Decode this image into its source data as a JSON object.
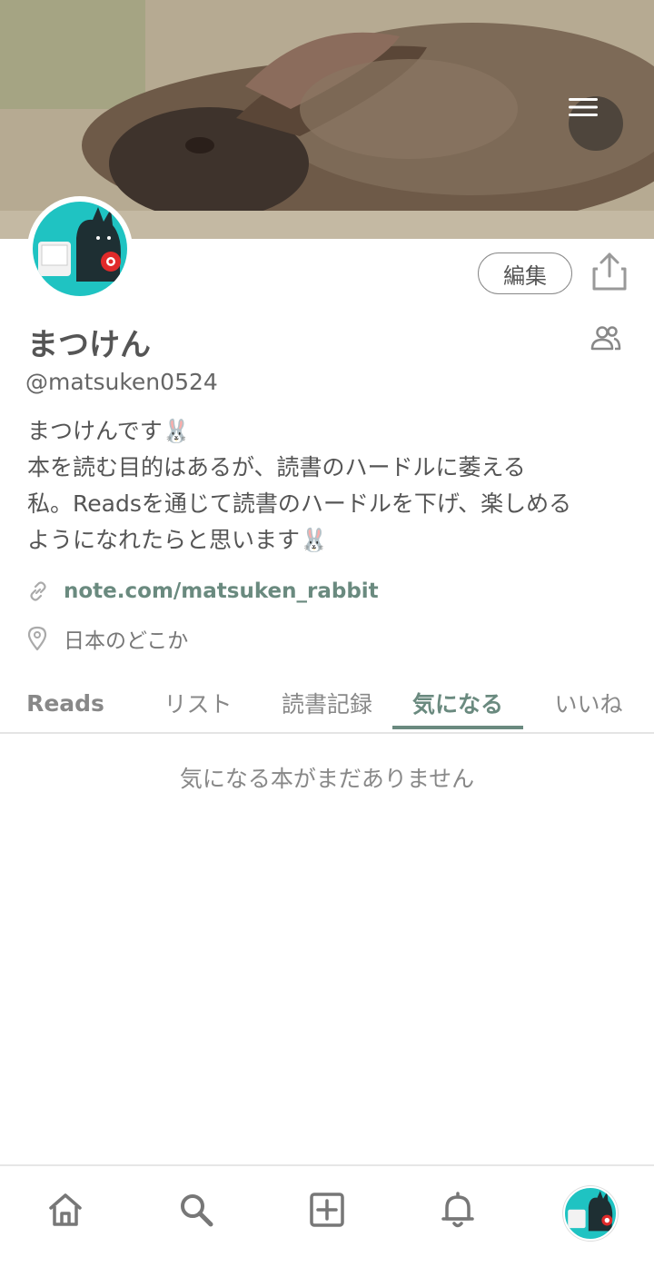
{
  "profile": {
    "name": "まつけん",
    "handle": "@matsuken0524",
    "bio_lines": [
      "まつけんです🐰",
      "本を読む目的はあるが、読書のハードルに萎える",
      "私。Readsを通じて読書のハードルを下げ、楽しめる",
      "ようになれたらと思います🐰"
    ],
    "link": "note.com/matsuken_rabbit",
    "location": "日本のどこか"
  },
  "actions": {
    "edit_label": "編集"
  },
  "tabs": [
    {
      "label": "Reads"
    },
    {
      "label": "リスト"
    },
    {
      "label": "読書記録"
    },
    {
      "label": "気になる"
    },
    {
      "label": "いいね"
    }
  ],
  "active_tab": "気になる",
  "empty_state": "気になる本がまだありません",
  "colors": {
    "accent": "#6a8a7f",
    "avatar_bg": "#1fc3c2",
    "text": "#555555"
  },
  "icons": [
    "menu-icon",
    "share-icon",
    "followers-icon",
    "link-icon",
    "location-pin-icon",
    "home-icon",
    "search-icon",
    "add-icon",
    "bell-icon"
  ]
}
